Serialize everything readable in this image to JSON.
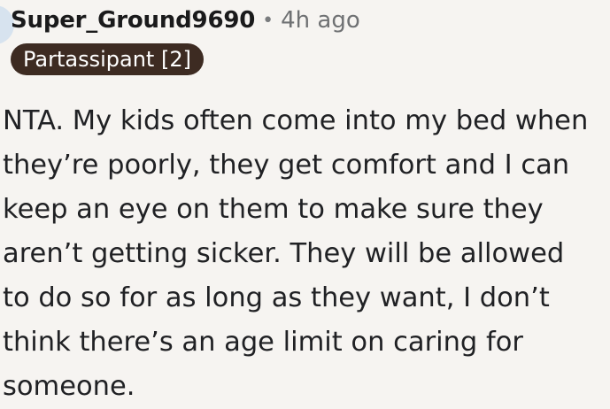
{
  "comment": {
    "author": "Super_Ground9690",
    "separator": "•",
    "timestamp": "4h ago",
    "flair": "Partassipant [2]",
    "body_lines": [
      "NTA. My kids often come into my bed when",
      "they’re poorly, they get comfort and I can",
      "keep an eye on them to make sure they",
      "aren’t getting sicker. They will be allowed",
      "to do so for as long as they want, I don’t",
      "think there’s an age limit on caring for",
      "someone."
    ]
  }
}
